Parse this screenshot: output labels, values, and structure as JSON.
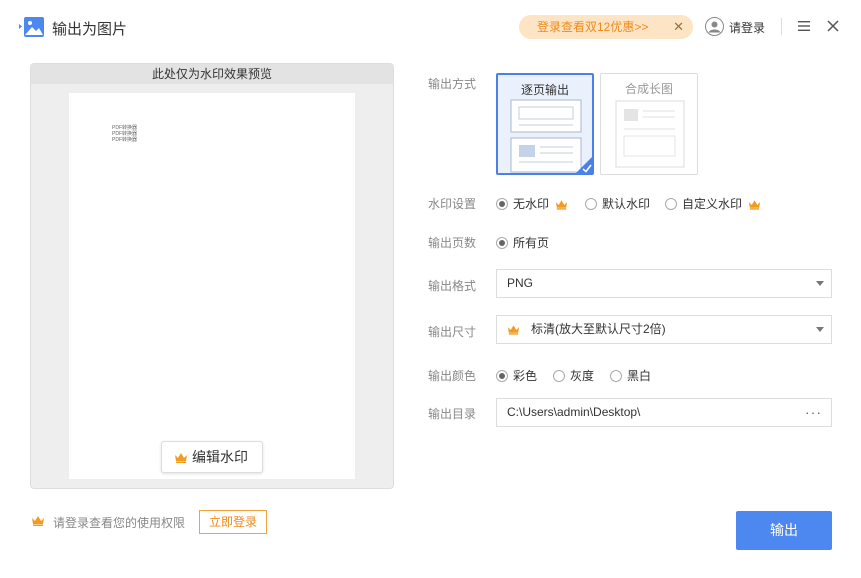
{
  "titlebar": {
    "title": "输出为图片",
    "app_icon": "image-icon",
    "promo_text": "登录查看双12优惠>>",
    "promo_close": "✕",
    "login_text": "请登录"
  },
  "preview": {
    "header": "此处仅为水印效果预览",
    "page_lines": [
      "PDF转换器",
      "PDF转换器",
      "PDF转换器"
    ],
    "edit_watermark_label": "编辑水印"
  },
  "footer": {
    "login_hint": "请登录查看您的使用权限",
    "login_now_label": "立即登录",
    "export_label": "输出"
  },
  "settings": {
    "output_mode": {
      "label": "输出方式",
      "options": [
        {
          "label": "逐页输出",
          "selected": true
        },
        {
          "label": "合成长图",
          "selected": false
        }
      ]
    },
    "watermark": {
      "label": "水印设置",
      "options": [
        {
          "label": "无水印",
          "selected": true,
          "premium": true
        },
        {
          "label": "默认水印",
          "selected": false,
          "premium": false
        },
        {
          "label": "自定义水印",
          "selected": false,
          "premium": true
        }
      ]
    },
    "pages": {
      "label": "输出页数",
      "options": [
        {
          "label": "所有页",
          "selected": true
        }
      ]
    },
    "format": {
      "label": "输出格式",
      "value": "PNG"
    },
    "size": {
      "label": "输出尺寸",
      "value": "标清(放大至默认尺寸2倍)"
    },
    "color": {
      "label": "输出颜色",
      "options": [
        {
          "label": "彩色",
          "selected": true
        },
        {
          "label": "灰度",
          "selected": false
        },
        {
          "label": "黑白",
          "selected": false
        }
      ]
    },
    "directory": {
      "label": "输出目录",
      "value": "C:\\Users\\admin\\Desktop\\",
      "more": "···"
    }
  },
  "colors": {
    "accent": "#4d87f0",
    "premium": "#f29b1e",
    "promo_bg": "#fde4c4"
  }
}
